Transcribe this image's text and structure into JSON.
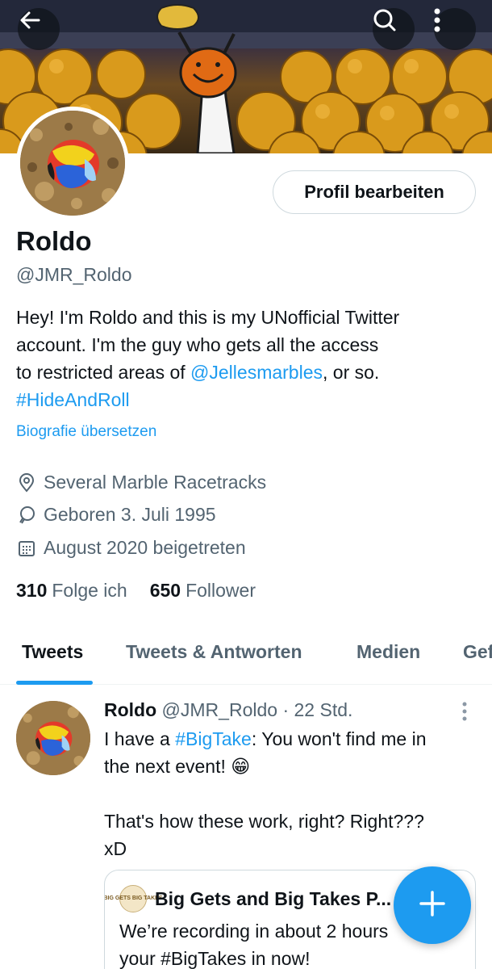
{
  "header": {
    "back_icon": "arrow-left-icon",
    "search_icon": "search-icon",
    "more_icon": "more-vertical-icon"
  },
  "profile": {
    "edit_button_label": "Profil bearbeiten",
    "name": "Roldo",
    "handle": "@JMR_Roldo",
    "bio": {
      "line1": "Hey! I'm Roldo and this is my UNofficial Twitter",
      "line2": "account. I'm the guy who gets all the access",
      "line3_pre": "to restricted areas of ",
      "line3_mention": "@Jellesmarbles",
      "line3_post": ", or so.",
      "line4_hashtag": "#HideAndRoll"
    },
    "translate_label": "Biografie übersetzen",
    "location": "Several Marble Racetracks",
    "birthday": "Geboren 3. Juli 1995",
    "joined": "August 2020 beigetreten",
    "following_count": "310",
    "following_label": "Folge ich",
    "followers_count": "650",
    "followers_label": "Follower"
  },
  "tabs": [
    {
      "label": "Tweets",
      "active": true
    },
    {
      "label": "Tweets & Antworten",
      "active": false
    },
    {
      "label": "Medien",
      "active": false
    },
    {
      "label": "Gef",
      "active": false
    }
  ],
  "tweet": {
    "author_name": "Roldo",
    "author_handle": "@JMR_Roldo",
    "separator": "·",
    "time": "22 Std.",
    "line1_pre": "I have a ",
    "line1_hashtag": "#BigTake",
    "line1_post": ": You won't find me in",
    "line2": "the next event! 😁",
    "line3": "That's how these work, right? Right???",
    "line4": "xD",
    "quote": {
      "avatar_text": "BIG GETS BIG TAKES",
      "name": "Big Gets and Big Takes P...",
      "line1": "We’re recording in about 2 hours",
      "line2": "your #BigTakes in now!"
    }
  },
  "fab_icon": "plus-icon",
  "colors": {
    "accent": "#1d9bf0",
    "text": "#0f1419",
    "secondary": "#536471",
    "border": "#cfd9de"
  }
}
